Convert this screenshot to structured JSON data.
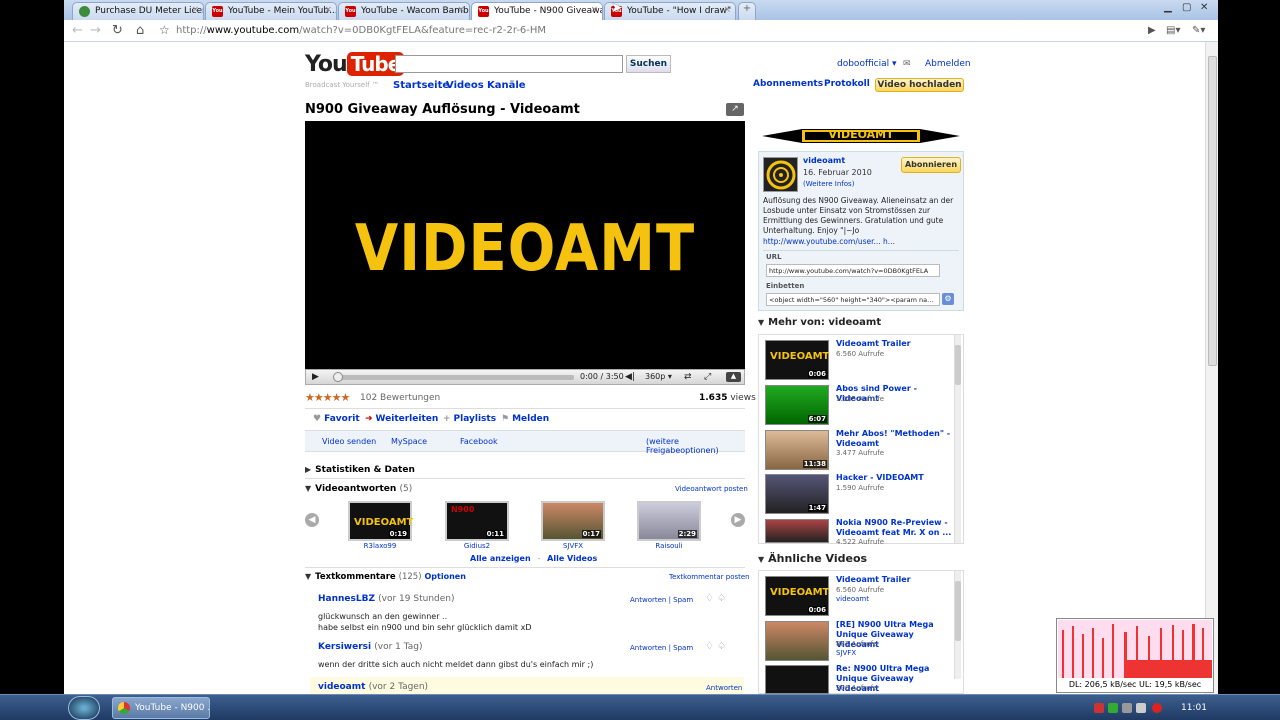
{
  "browser": {
    "tabs": [
      {
        "title": "Purchase DU Meter License",
        "active": false
      },
      {
        "title": "YouTube - Mein YouTub...",
        "active": false
      },
      {
        "title": "YouTube - Wacom Bamb...",
        "active": false
      },
      {
        "title": "YouTube - N900 Giveawa...",
        "active": true
      },
      {
        "title": "YouTube - \"How I draw\" ...",
        "active": false
      }
    ],
    "url_prefix": "http://",
    "url_host": "www.youtube.com",
    "url_path": "/watch?v=0DB0KgtFELA&feature=rec-r2-2r-6-HM"
  },
  "header": {
    "logo_you": "You",
    "logo_tube": "Tube",
    "slogan": "Broadcast Yourself ™",
    "search_button": "Suchen",
    "nav": [
      "Startseite",
      "Videos",
      "Kanäle"
    ],
    "username": "doboofficial",
    "logout": "Abmelden",
    "subscriptions": "Abonnements",
    "history": "Protokoll",
    "upload": "Video hochladen"
  },
  "video": {
    "title": "N900 Giveaway Auflösung - Videoamt",
    "player_logo": "VIDEOAMT",
    "time": "0:00 / 3:50",
    "quality": "360p",
    "progress": 0.0,
    "rating_stars": 4.5,
    "ratings": "102 Bewertungen",
    "views_count": "1.635",
    "views_label": "views"
  },
  "actions": {
    "favorite": "Favorit",
    "share": "Weiterleiten",
    "playlists": "Playlists",
    "flag": "Melden"
  },
  "share": {
    "send": "Video senden",
    "myspace": "MySpace",
    "facebook": "Facebook",
    "more": "(weitere Freigabeoptionen)"
  },
  "stats_header": "Statistiken & Daten",
  "video_responses": {
    "header": "Videoantworten",
    "count": "(5)",
    "post": "Videoantwort posten",
    "items": [
      {
        "name": "R3laxo99",
        "duration": "0:19"
      },
      {
        "name": "Gidius2",
        "duration": "0:11"
      },
      {
        "name": "SJVFX",
        "duration": "0:17"
      },
      {
        "name": "Raisouli",
        "duration": "2:29"
      }
    ],
    "show_all": "Alle anzeigen",
    "separator": "-",
    "all_videos": "Alle Videos"
  },
  "comments": {
    "header": "Textkommentare",
    "count": "(125)",
    "options": "Optionen",
    "post": "Textkommentar posten",
    "reply": "Antworten",
    "divider": "|",
    "spam": "Spam",
    "items": [
      {
        "user": "HannesLBZ",
        "time": "(vor 19 Stunden)",
        "line1": "glückwunsch an den gewinner ..",
        "line2": "habe selbst ein n900 und bin sehr glücklich damit xD"
      },
      {
        "user": "Kersiwersi",
        "time": "(vor 1 Tag)",
        "line1": "wenn der dritte sich auch nicht meldet dann gibst du's einfach mir ;)",
        "line2": ""
      },
      {
        "user": "videoamt",
        "time": "(vor 2 Tagen)",
        "line1": "",
        "line2": ""
      }
    ]
  },
  "channel": {
    "banner": "VIDEOAMT",
    "name": "videoamt",
    "date": "16. Februar 2010",
    "more_info": "(Weitere Infos)",
    "subscribe": "Abonnieren",
    "description": "Auflösung des N900 Giveaway. Alieneinsatz an der Losbude unter Einsatz von Stromstössen zur Ermittlung des Gewinners. Gratulation und gute Unterhaltung. Enjoy \"|~Jo",
    "desc_link": "http://www.youtube.com/user... h...",
    "url_label": "URL",
    "url_value": "http://www.youtube.com/watch?v=0DB0KgtFELA",
    "embed_label": "Einbetten",
    "embed_value": "<object width=\"560\" height=\"340\"><param name=\"m"
  },
  "more_from": {
    "header": "Mehr von: videoamt",
    "items": [
      {
        "title": "Videoamt Trailer",
        "views": "6.560 Aufrufe",
        "duration": "0:06"
      },
      {
        "title": "Abos sind Power - Videoamt",
        "views": "1.185 Aufrufe",
        "duration": "6:07"
      },
      {
        "title": "Mehr Abos! \"Methoden\" - Videoamt",
        "views": "3.477 Aufrufe",
        "duration": "11:38"
      },
      {
        "title": "Hacker - VIDEOAMT",
        "views": "1.590 Aufrufe",
        "duration": "1:47"
      },
      {
        "title": "Nokia N900 Re-Preview - Videoamt feat Mr. X on ...",
        "views": "4.522 Aufrufe",
        "duration": ""
      }
    ]
  },
  "related": {
    "header": "Ähnliche Videos",
    "items": [
      {
        "title": "Videoamt Trailer",
        "views": "6.560 Aufrufe",
        "author": "videoamt",
        "duration": "0:06"
      },
      {
        "title": "[RE] N900 Ultra Mega Unique Giveaway Videoamt",
        "views": "882 Aufrufe",
        "author": "SJVFX",
        "duration": ""
      },
      {
        "title": "Re: N900 Ultra Mega Unique Giveaway Videoamt",
        "views": "206 Aufrufe",
        "author": "",
        "duration": ""
      }
    ]
  },
  "du_meter": {
    "readout": "DL: 206,5 kB/sec  UL: 19,5 kB/sec"
  },
  "taskbar": {
    "window": "YouTube - N900 ...",
    "clock": "11:01"
  },
  "colors": {
    "link": "#0033cc",
    "yt_red": "#dd2200",
    "logo_yellow": "#f5c30f",
    "upload_yellow": "#fad65a"
  }
}
